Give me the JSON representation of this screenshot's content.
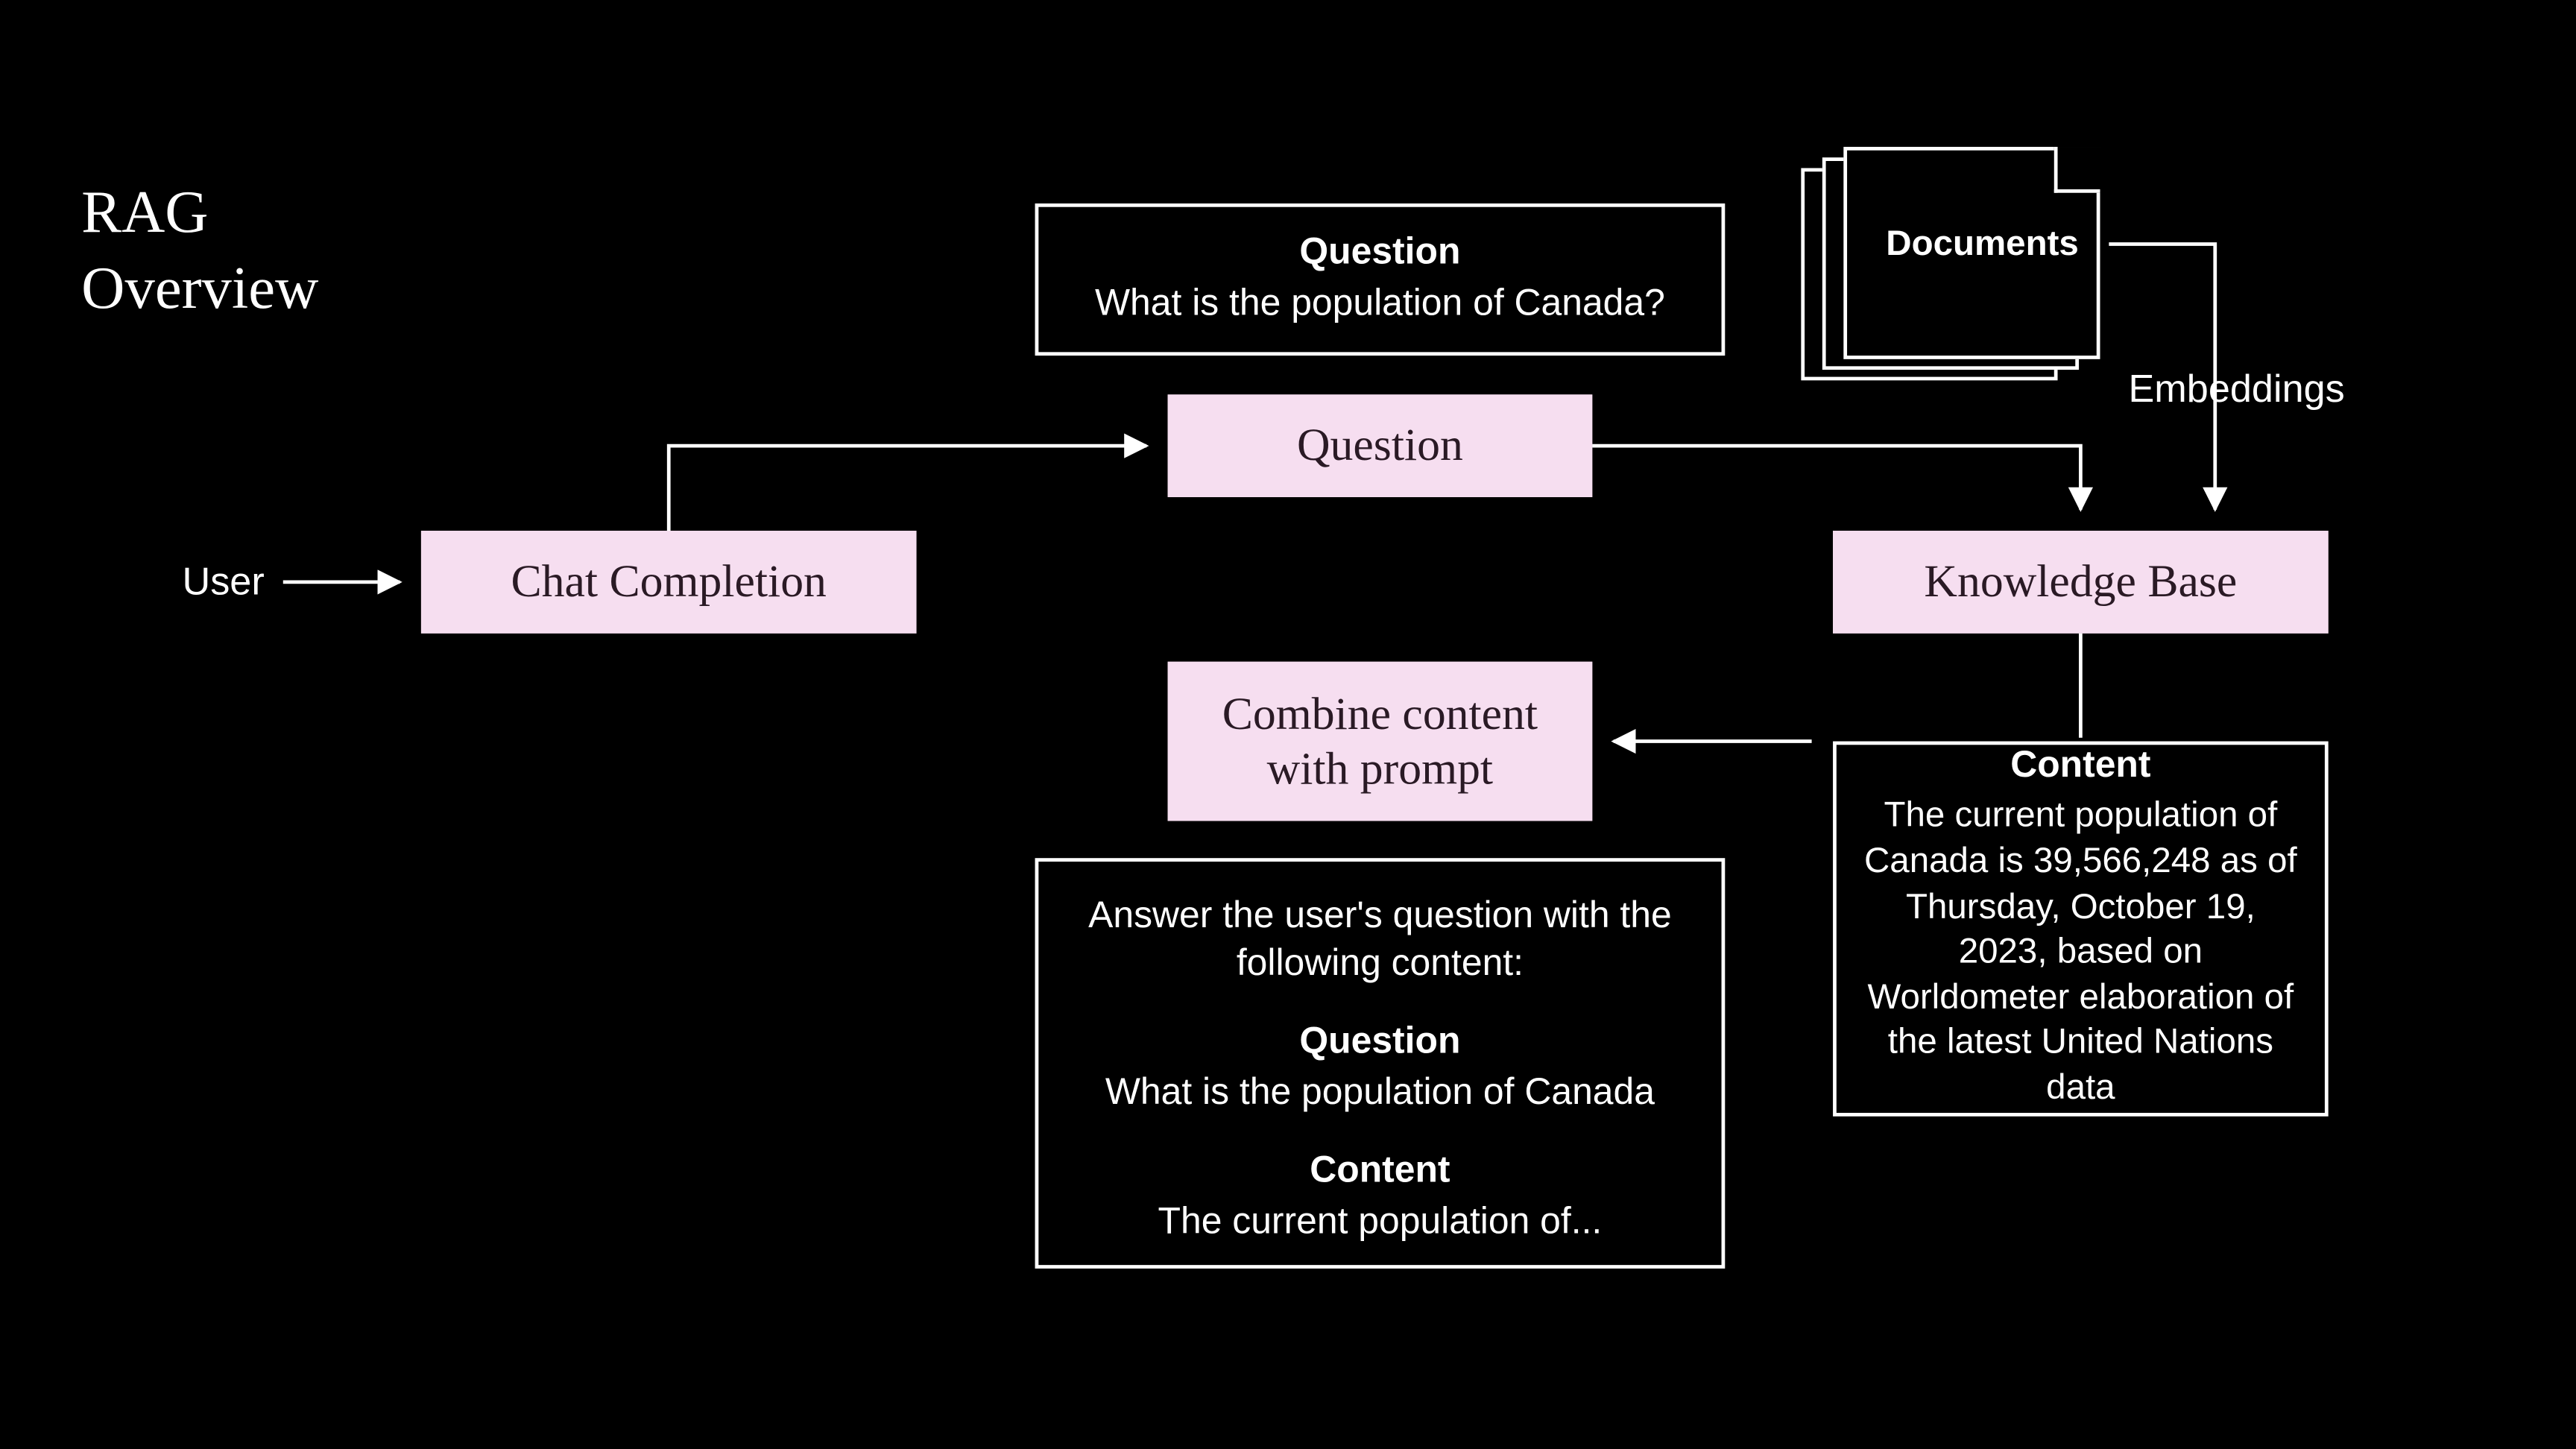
{
  "title_line1": "RAG",
  "title_line2": "Overview",
  "user_label": "User",
  "embeddings_label": "Embeddings",
  "documents_label": "Documents",
  "pink": {
    "chat_completion": "Chat Completion",
    "question_node": "Question",
    "combine_line1": "Combine content",
    "combine_line2": "with prompt",
    "knowledge_base": "Knowledge Base"
  },
  "question_box": {
    "header": "Question",
    "body": "What is the population of Canada?"
  },
  "content_box": {
    "header": "Content",
    "body": "The current population of Canada is 39,566,248 as of Thursday, October 19, 2023, based on Worldometer elaboration of the latest United Nations data"
  },
  "prompt_box": {
    "intro": "Answer the user's question with the following content:",
    "q_header": "Question",
    "q_body": "What is the population of Canada",
    "c_header": "Content",
    "c_body": "The current population of..."
  }
}
